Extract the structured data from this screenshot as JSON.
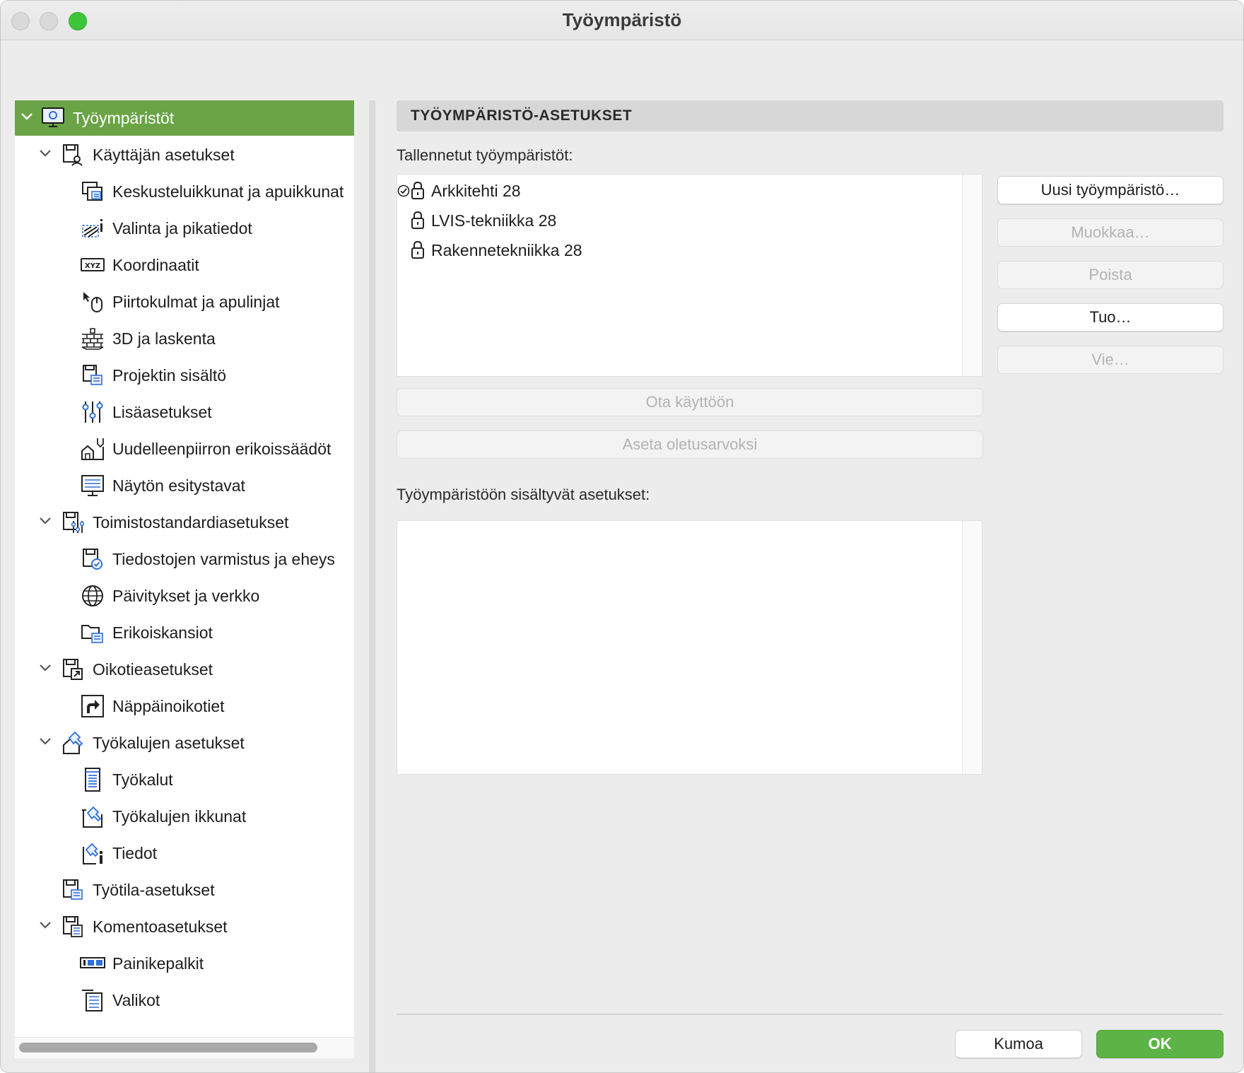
{
  "window": {
    "title": "Työympäristö"
  },
  "tree": {
    "root": {
      "label": "Työympäristöt",
      "icon": "monitor-icon"
    },
    "items": [
      {
        "label": "Käyttäjän asetukset",
        "icon": "user-settings-icon"
      },
      {
        "label": "Keskusteluikkunat ja apuikkunat",
        "icon": "dialog-windows-icon"
      },
      {
        "label": "Valinta ja pikatiedot",
        "icon": "selection-info-icon"
      },
      {
        "label": "Koordinaatit",
        "icon": "xyz-coordinates-icon"
      },
      {
        "label": "Piirtokulmat ja apulinjat",
        "icon": "mouse-cursor-icon"
      },
      {
        "label": "3D ja laskenta",
        "icon": "bricks-icon"
      },
      {
        "label": "Projektin sisältö",
        "icon": "project-content-icon"
      },
      {
        "label": "Lisäasetukset",
        "icon": "sliders-icon"
      },
      {
        "label": "Uudelleenpiirron erikoissäädöt",
        "icon": "redraw-icon"
      },
      {
        "label": "Näytön esitystavat",
        "icon": "display-options-icon"
      },
      {
        "label": "Toimistostandardiasetukset",
        "icon": "company-standards-icon"
      },
      {
        "label": "Tiedostojen varmistus ja eheys",
        "icon": "file-safety-icon"
      },
      {
        "label": "Päivitykset ja verkko",
        "icon": "globe-icon"
      },
      {
        "label": "Erikoiskansiot",
        "icon": "special-folders-icon"
      },
      {
        "label": "Oikotieasetukset",
        "icon": "shortcut-settings-icon"
      },
      {
        "label": "Näppäinoikotiet",
        "icon": "keyboard-shortcut-icon"
      },
      {
        "label": "Työkalujen asetukset",
        "icon": "tool-settings-icon"
      },
      {
        "label": "Työkalut",
        "icon": "toolbox-icon"
      },
      {
        "label": "Työkalujen ikkunat",
        "icon": "tool-windows-icon"
      },
      {
        "label": "Tiedot",
        "icon": "info-icon"
      },
      {
        "label": "Työtila-asetukset",
        "icon": "workspace-settings-icon"
      },
      {
        "label": "Komentoasetukset",
        "icon": "command-settings-icon"
      },
      {
        "label": "Painikepalkit",
        "icon": "toolbar-icon"
      },
      {
        "label": "Valikot",
        "icon": "menus-icon"
      }
    ]
  },
  "panel": {
    "header": "TYÖYMPÄRISTÖ-ASETUKSET",
    "saved_label": "Tallennetut työympäristöt:",
    "saved_items": [
      {
        "label": "Arkkitehti 28",
        "active": true
      },
      {
        "label": "LVIS-tekniikka 28",
        "active": false
      },
      {
        "label": "Rakennetekniikka 28",
        "active": false
      }
    ],
    "included_label": "Työympäristöön sisältyvät asetukset:"
  },
  "buttons": {
    "new": "Uusi työympäristö…",
    "edit": "Muokkaa…",
    "delete": "Poista",
    "import": "Tuo…",
    "export": "Vie…",
    "apply": "Ota käyttöön",
    "set_default": "Aseta oletusarvoksi",
    "cancel": "Kumoa",
    "ok": "OK"
  },
  "colors": {
    "selection": "#6aa446",
    "ok_button": "#5cb446"
  }
}
